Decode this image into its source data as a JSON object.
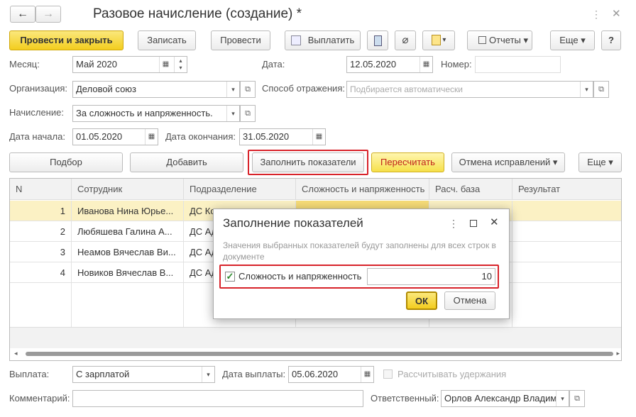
{
  "window": {
    "title": "Разовое начисление (создание) *"
  },
  "toolbar": {
    "post_close": "Провести и закрыть",
    "save": "Записать",
    "post": "Провести",
    "pay": "Выплатить",
    "reports": "Отчеты",
    "more": "Еще",
    "help": "?"
  },
  "form": {
    "month_label": "Месяц:",
    "month_value": "Май 2020",
    "date_label": "Дата:",
    "date_value": "12.05.2020",
    "number_label": "Номер:",
    "number_value": "",
    "org_label": "Организация:",
    "org_value": "Деловой союз",
    "reflect_label": "Способ отражения:",
    "reflect_placeholder": "Подбирается автоматически",
    "accrual_label": "Начисление:",
    "accrual_value": "За сложность и напряженность.",
    "start_label": "Дата начала:",
    "start_value": "01.05.2020",
    "end_label": "Дата окончания:",
    "end_value": "31.05.2020"
  },
  "actions": {
    "select": "Подбор",
    "add": "Добавить",
    "fill": "Заполнить показатели",
    "recalc": "Пересчитать",
    "cancel_fix": "Отмена исправлений",
    "more": "Еще"
  },
  "table": {
    "headers": [
      "N",
      "Сотрудник",
      "Подразделение",
      "Сложность и напряженность",
      "Расч. база",
      "Результат"
    ],
    "rows": [
      {
        "n": "1",
        "emp": "Иванова Нина Юрье...",
        "dep": "ДС Ко"
      },
      {
        "n": "2",
        "emp": "Любяшева Галина А...",
        "dep": "ДС Ад"
      },
      {
        "n": "3",
        "emp": "Неамов Вячеслав Ви...",
        "dep": "ДС Ад"
      },
      {
        "n": "4",
        "emp": "Новиков Вячеслав В...",
        "dep": "ДС Ад"
      }
    ]
  },
  "footer": {
    "payout_label": "Выплата:",
    "payout_value": "С зарплатой",
    "paydate_label": "Дата выплаты:",
    "paydate_value": "05.06.2020",
    "deduct_label": "Рассчитывать удержания",
    "comment_label": "Комментарий:",
    "comment_value": "",
    "resp_label": "Ответственный:",
    "resp_value": "Орлов Александр Владим"
  },
  "dialog": {
    "title": "Заполнение показателей",
    "hint": "Значения выбранных показателей будут заполнены для всех строк в документе",
    "check_label": "Сложность и напряженность",
    "value": "10",
    "ok": "ОК",
    "cancel": "Отмена"
  },
  "colors": {
    "accent_yellow": "#f3cd1e",
    "highlight_red": "#d8232a",
    "selected_row": "#fbf1c4"
  }
}
